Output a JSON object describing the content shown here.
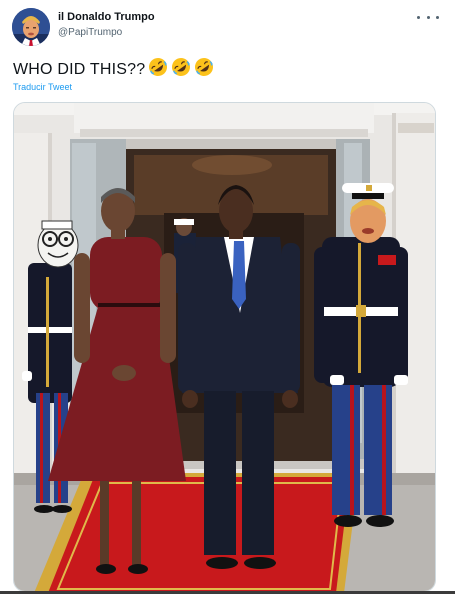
{
  "tweet": {
    "display_name": "il Donaldo Trumpo",
    "handle": "@PapiTrumpo",
    "text": "WHO DID THIS??",
    "emojis": [
      "rolling-on-floor-laughing",
      "rolling-on-floor-laughing",
      "rolling-on-floor-laughing"
    ],
    "translate_label": "Traducir Tweet",
    "more_icon": "more-dots-icon"
  },
  "colors": {
    "link_blue": "#1d9bf0",
    "secondary_text": "#536471",
    "carpet_red": "#c8191c",
    "carpet_gold": "#d4a93a",
    "dress_red": "#7c1c22",
    "suit_navy": "#1c2235",
    "marine_blue": "#0f1a35"
  }
}
